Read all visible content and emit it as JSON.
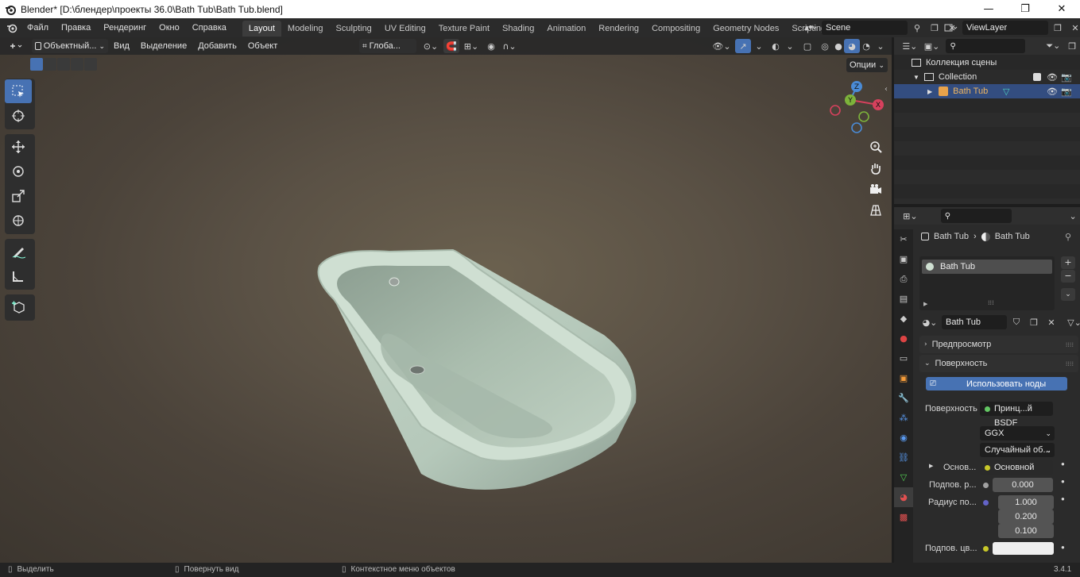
{
  "window": {
    "title": "Blender* [D:\\блендер\\проекты 36.0\\Bath Tub\\Bath Tub.blend]",
    "minimize": "—",
    "maximize": "❐",
    "close": "✕"
  },
  "menu": [
    "Файл",
    "Правка",
    "Рендеринг",
    "Окно",
    "Справка"
  ],
  "workspaces": [
    "Layout",
    "Modeling",
    "Sculpting",
    "UV Editing",
    "Texture Paint",
    "Shading",
    "Animation",
    "Rendering",
    "Compositing",
    "Geometry Nodes",
    "Scripting"
  ],
  "active_workspace": "Layout",
  "scene": {
    "name": "Scene",
    "view_layer": "ViewLayer"
  },
  "viewport": {
    "mode": "Объектный...",
    "menus": [
      "Вид",
      "Выделение",
      "Добавить",
      "Объект"
    ],
    "transform_orientation": "Глоба...",
    "options": "Опции",
    "gizmo": {
      "x": "X",
      "y": "Y",
      "z": "Z"
    },
    "object_color": "#b8cbbd"
  },
  "outliner": {
    "scene_collection": "Коллекция сцены",
    "collection": "Collection",
    "object": "Bath Tub"
  },
  "properties": {
    "breadcrumb": [
      "Bath Tub",
      "Bath Tub"
    ],
    "material_slot": "Bath Tub",
    "material_name": "Bath Tub",
    "preview_label": "Предпросмотр",
    "surface_panel": "Поверхность",
    "use_nodes": "Использовать ноды",
    "surface_label": "Поверхность",
    "surface_value": "Принц...й BSDF",
    "distribution": "GGX",
    "subsurface_method": "Случайный об...",
    "base_label": "Основ...",
    "base_value": "Основной цвет",
    "subsurface_label": "Подпов. р...",
    "subsurface_value": "0.000",
    "radius_label": "Радиус по...",
    "radius_values": [
      "1.000",
      "0.200",
      "0.100"
    ],
    "subsurface_color_label": "Подпов. цв...",
    "subsurface_color": "#efefef"
  },
  "status": {
    "select": "Выделить",
    "rotate": "Повернуть вид",
    "context": "Контекстное меню объектов",
    "version": "3.4.1"
  }
}
